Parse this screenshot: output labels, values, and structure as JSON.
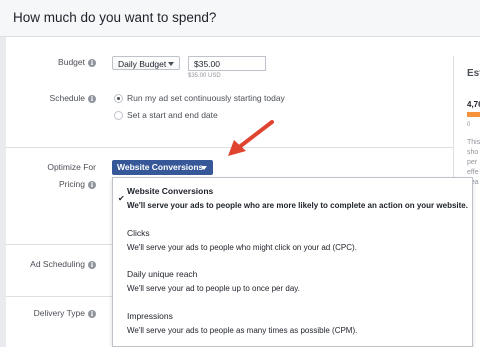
{
  "header": {
    "title": "How much do you want to spend?"
  },
  "budget": {
    "label": "Budget",
    "type_select": "Daily Budget",
    "amount": "$35.00",
    "amount_note": "$35.00 USD"
  },
  "schedule": {
    "label": "Schedule",
    "options": [
      {
        "label": "Run my ad set continuously starting today",
        "selected": true
      },
      {
        "label": "Set a start and end date",
        "selected": false
      }
    ]
  },
  "optimize": {
    "label": "Optimize For",
    "selected": "Website Conversions"
  },
  "pricing": {
    "label": "Pricing"
  },
  "ad_scheduling": {
    "label": "Ad Scheduling"
  },
  "delivery_type": {
    "label": "Delivery Type"
  },
  "dropdown": {
    "items": [
      {
        "title": "Website Conversions",
        "desc": "We'll serve your ads to people who are more likely to complete an action on your website.",
        "selected": true
      },
      {
        "title": "Clicks",
        "desc": "We'll serve your ads to people who might click on your ad (CPC).",
        "selected": false
      },
      {
        "title": "Daily unique reach",
        "desc": "We'll serve your ad to people up to once per day.",
        "selected": false
      },
      {
        "title": "Impressions",
        "desc": "We'll serve your ads to people as many times as possible (CPM).",
        "selected": false
      }
    ],
    "check_glyph": "✔"
  },
  "estimate": {
    "title": "Est",
    "number": "4,76",
    "zero": "0",
    "lines": [
      "This",
      "sho",
      "per",
      "effe",
      "Lea"
    ]
  },
  "colors": {
    "button": "#365899",
    "arrow": "#e0432f",
    "bar": "#f7923b"
  },
  "icons": {
    "info": "info-icon",
    "caret": "caret-down-icon",
    "check": "checkmark-icon",
    "annotation": "red-arrow-annotation"
  }
}
